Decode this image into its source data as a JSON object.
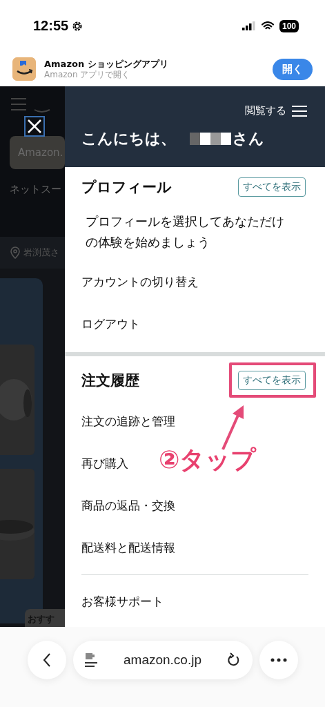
{
  "status_bar": {
    "time": "12:55",
    "battery": "100"
  },
  "app_banner": {
    "title": "Amazon ショッピングアプリ",
    "subtitle": "Amazon アプリで開く",
    "button": "開く"
  },
  "background_page": {
    "search_placeholder": "Amazon.",
    "nav_text": "ネットスー",
    "location": "岩渕茂さ",
    "section_label": "おすす"
  },
  "drawer": {
    "browse_label": "閲覧する",
    "greeting_prefix": "こんにちは、",
    "greeting_suffix": "さん",
    "sections": [
      {
        "title": "プロフィール",
        "view_all": "すべてを表示",
        "highlighted": false,
        "description": "プロフィールを選択してあなただけの体験を始めましょう",
        "items": [
          "アカウントの切り替え",
          "ログアウト"
        ]
      },
      {
        "title": "注文履歴",
        "view_all": "すべてを表示",
        "highlighted": true,
        "items": [
          "注文の追跡と管理",
          "再び購入",
          "商品の返品・交換",
          "配送料と配送情報"
        ]
      }
    ],
    "footer_items": [
      "お客様サポート"
    ]
  },
  "annotation": {
    "text": "②タップ"
  },
  "browser_bar": {
    "url": "amazon.co.jp"
  }
}
